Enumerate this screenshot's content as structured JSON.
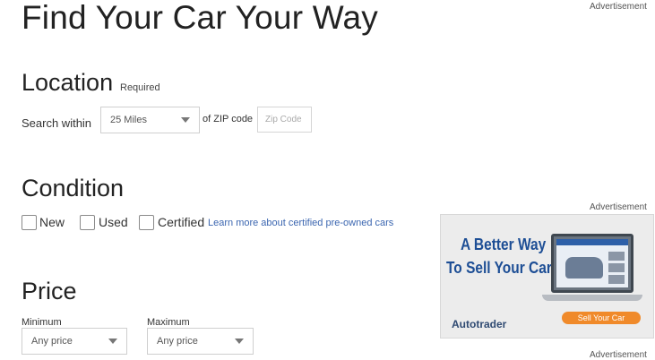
{
  "header": {
    "title": "Find Your Car Your Way",
    "top_ad_label": "Advertisement"
  },
  "location": {
    "title": "Location",
    "required": "Required",
    "search_within_label": "Search within",
    "radius_value": "25 Miles",
    "zip_label": "of ZIP code",
    "zip_placeholder": "Zip Code"
  },
  "condition": {
    "title": "Condition",
    "options": [
      {
        "label": "New",
        "checked": false
      },
      {
        "label": "Used",
        "checked": false
      },
      {
        "label": "Certified",
        "checked": false
      }
    ],
    "learn_more_link": "Learn more about certified pre-owned cars"
  },
  "price": {
    "title": "Price",
    "minimum_label": "Minimum",
    "minimum_value": "Any price",
    "maximum_label": "Maximum",
    "maximum_value": "Any price"
  },
  "side_ad": {
    "top_label": "Advertisement",
    "line1": "A Better Way",
    "line2": "To Sell Your Car",
    "brand": "Autotrader",
    "cta": "Sell Your Car",
    "bottom_label": "Advertisement"
  }
}
